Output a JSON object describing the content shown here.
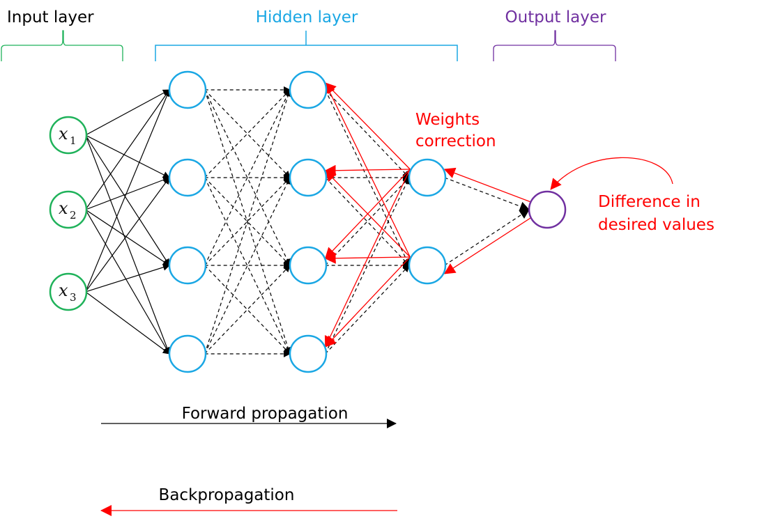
{
  "colors": {
    "input": "#1fb25a",
    "hidden": "#1aa7e4",
    "output": "#7030a0",
    "backprop": "#ff0000",
    "forward": "#000000"
  },
  "layers": {
    "input": {
      "label": "Input layer",
      "nodes": [
        {
          "symbol": "x",
          "sub": "1"
        },
        {
          "symbol": "x",
          "sub": "2"
        },
        {
          "symbol": "x",
          "sub": "3"
        }
      ]
    },
    "hidden": {
      "label": "Hidden layer",
      "columns": [
        4,
        4,
        2
      ]
    },
    "output": {
      "label": "Output layer",
      "nodes": 1
    }
  },
  "annotations": {
    "weights_correction": [
      "Weights",
      "correction"
    ],
    "difference": [
      "Difference in",
      "desired values"
    ]
  },
  "legend": {
    "forward": "Forward propagation",
    "backward": "Backpropagation"
  }
}
